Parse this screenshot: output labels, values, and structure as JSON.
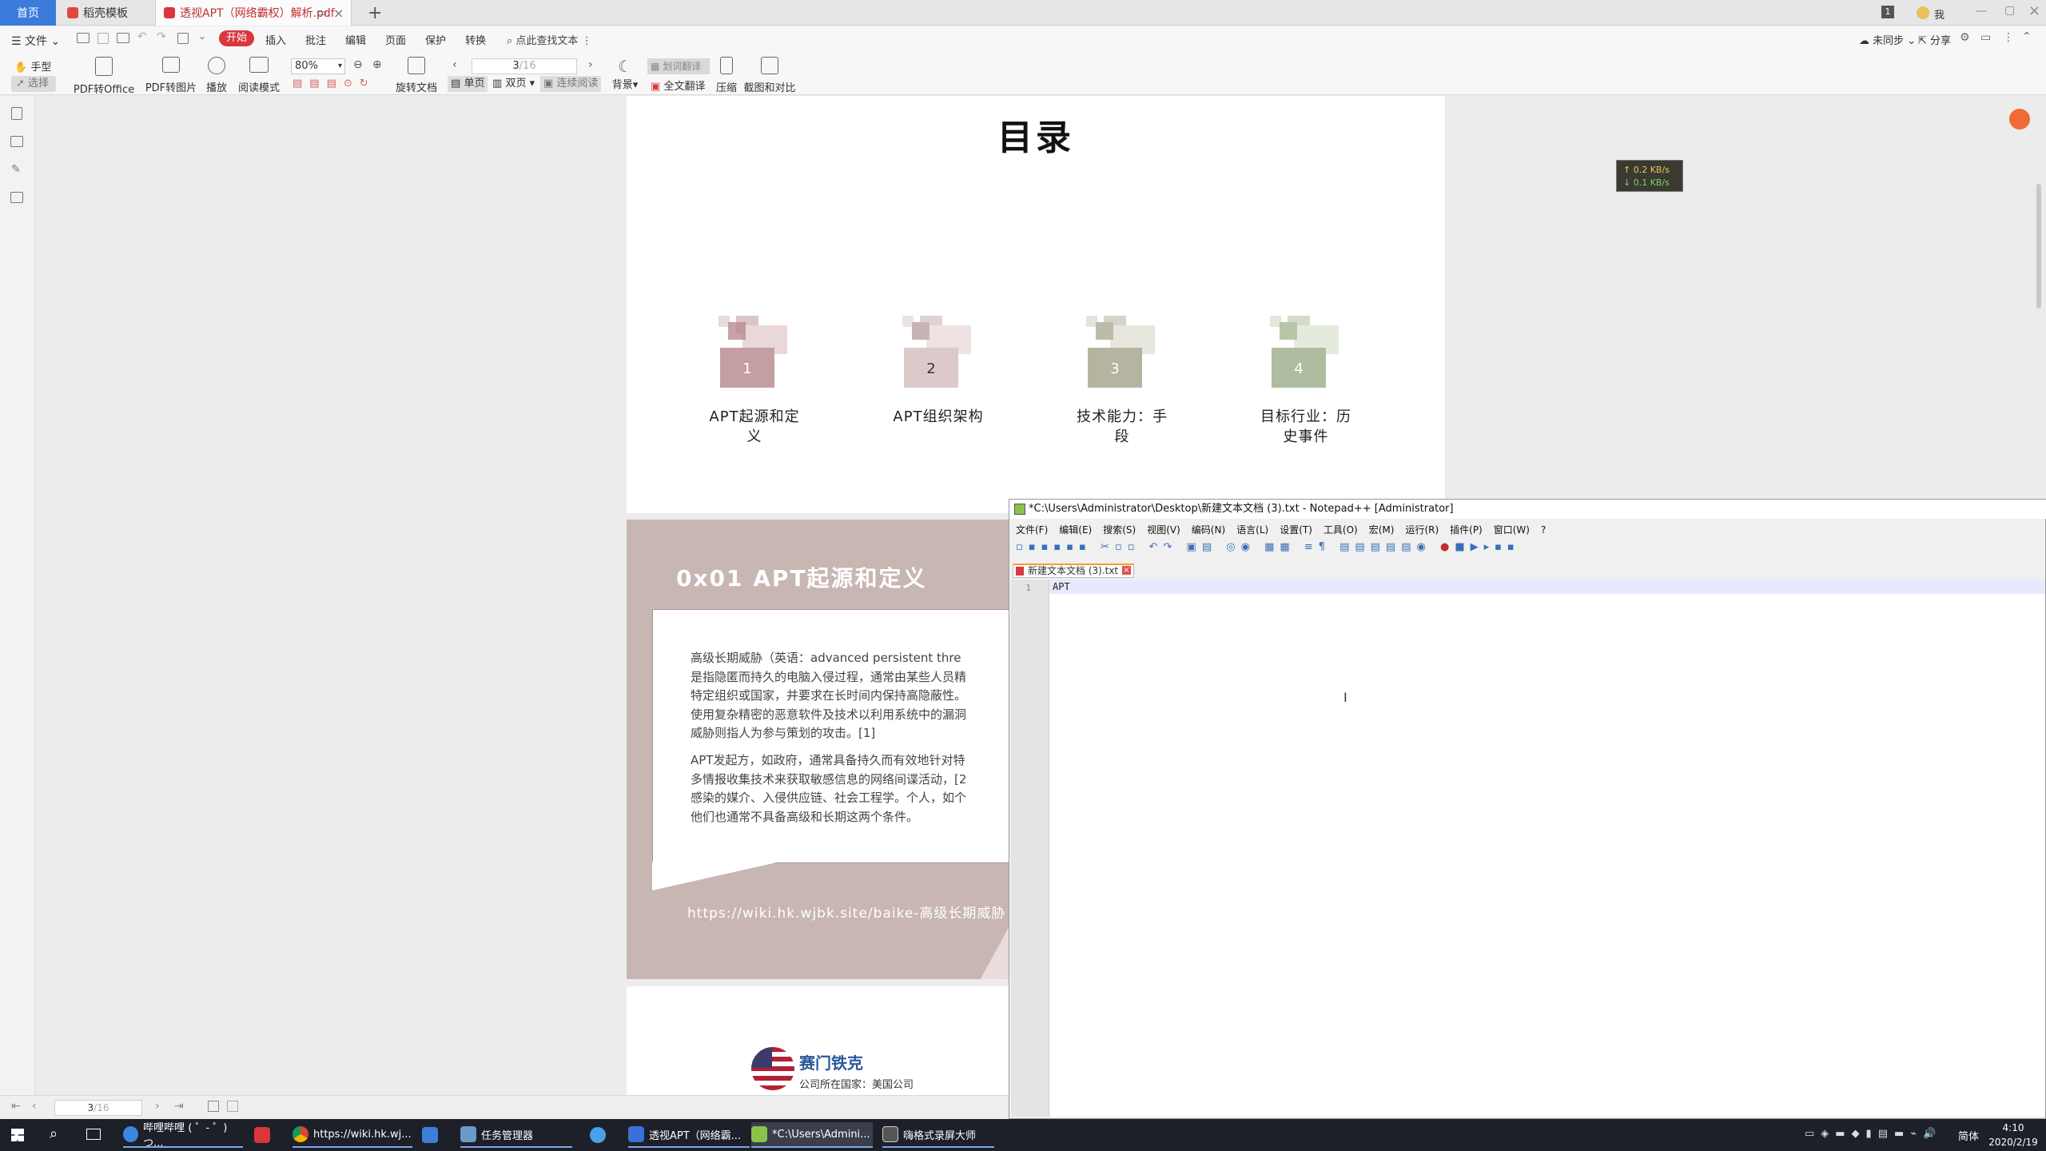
{
  "tabs": {
    "home": "首页",
    "template": "稻壳模板",
    "pdf": "透视APT（网络霸权）解析.pdf"
  },
  "topright": {
    "badge": "1",
    "user": "我"
  },
  "ribbon": {
    "file": "文件",
    "menus": [
      "开始",
      "插入",
      "批注",
      "编辑",
      "页面",
      "保护",
      "转换"
    ],
    "search": "点此查找文本",
    "sync": "未同步",
    "share": "分享",
    "hand": "手型",
    "select": "选择",
    "pdf_office": "PDF转Office",
    "pdf_image": "PDF转图片",
    "play": "播放",
    "read_mode": "阅读模式",
    "zoom": "80%",
    "rotate": "旋转文档",
    "page": "3",
    "page_total": "/16",
    "single": "单页",
    "double": "双页",
    "continuous": "连续阅读",
    "background": "背景",
    "word_translate": "划词翻译",
    "full_translate": "全文翻译",
    "compress": "压缩",
    "compare": "截图和对比"
  },
  "net_speed": {
    "up": "↑ 0.2 KB/s",
    "down": "↓ 0.1 KB/s"
  },
  "toc": {
    "title": "目录",
    "items": [
      {
        "num": "1",
        "label1": "APT起源和定",
        "label2": "义"
      },
      {
        "num": "2",
        "label1": "APT组织架构",
        "label2": ""
      },
      {
        "num": "3",
        "label1": "技术能力：手",
        "label2": "段"
      },
      {
        "num": "4",
        "label1": "目标行业：历",
        "label2": "史事件"
      }
    ]
  },
  "section": {
    "title": "0x01 APT起源和定义",
    "bullet1": [
      "高级长期威胁（英语：advanced persistent thre",
      "是指隐匿而持久的电脑入侵过程，通常由某些人员精",
      "特定组织或国家，并要求在长时间内保持高隐蔽性。",
      "使用复杂精密的恶意软件及技术以利用系统中的漏洞",
      "威胁则指人为参与策划的攻击。[1]"
    ],
    "bullet2": [
      "APT发起方，如政府，通常具备持久而有效地针对特",
      "多情报收集技术来获取敏感信息的网络间谍活动，[2",
      "感染的媒介、入侵供应链、社会工程学。个人，如个",
      "他们也通常不具备高级和长期这两个条件。"
    ],
    "url": "https://wiki.hk.wjbk.site/baike-高级长期威胁"
  },
  "page3": {
    "company": "赛门铁克",
    "country": "公司所在国家：美国公司"
  },
  "pdf_status": {
    "page": "3",
    "total": "/16"
  },
  "notepad": {
    "title": "*C:\\Users\\Administrator\\Desktop\\新建文本文档 (3).txt - Notepad++ [Administrator]",
    "menus": [
      "文件(F)",
      "编辑(E)",
      "搜索(S)",
      "视图(V)",
      "编码(N)",
      "语言(L)",
      "设置(T)",
      "工具(O)",
      "宏(M)",
      "运行(R)",
      "插件(P)",
      "窗口(W)",
      "?"
    ],
    "tab": "新建文本文档 (3).txt",
    "line_no": "1",
    "content": "APT"
  },
  "taskbar": {
    "items": [
      "哔哩哔哩 ( ゜- ゜)つ...",
      "",
      "https://wiki.hk.wj...",
      "",
      "任务管理器",
      "",
      "透视APT（网络霸...",
      "*C:\\Users\\Admini...",
      "嗨格式录屏大师"
    ],
    "ime": "简体",
    "time": "4:10",
    "date": "2020/2/19"
  },
  "colors": {
    "accent_red": "#d9363e",
    "pdf_section_bg": "#c8b6b3",
    "taskbar_bg": "#1d2029"
  }
}
